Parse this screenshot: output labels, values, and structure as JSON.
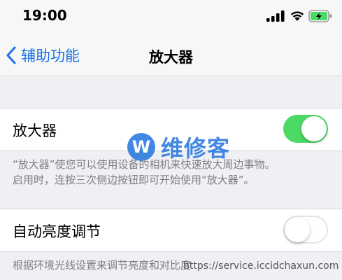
{
  "status_bar": {
    "time": "19:00"
  },
  "nav": {
    "back_label": "辅助功能",
    "title": "放大器"
  },
  "magnifier": {
    "label": "放大器",
    "enabled": true
  },
  "magnifier_footer": {
    "line1": "“放大器”使您可以使用设备的相机来快速放大周边事物。",
    "line2": "启用时，连按三次侧边按钮即可开始使用“放大器”。"
  },
  "auto_brightness": {
    "label": "自动亮度调节",
    "enabled": false
  },
  "auto_brightness_footer": "根据环境光线设置来调节亮度和对比度",
  "watermark": {
    "logo": "W",
    "text": "维修客",
    "url": "https://service.iccidchaxun.com"
  },
  "colors": {
    "accent": "#1a73e8",
    "toggle_on": "#4cd964",
    "background": "#efeff4"
  }
}
